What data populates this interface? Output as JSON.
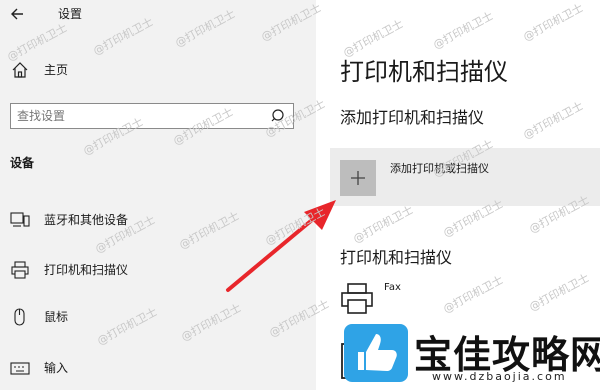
{
  "window": {
    "title": "设置"
  },
  "sidebar": {
    "home_label": "主页",
    "search_placeholder": "查找设置",
    "section_title": "设备",
    "items": [
      {
        "label": "蓝牙和其他设备",
        "icon": "bluetooth-devices-icon"
      },
      {
        "label": "打印机和扫描仪",
        "icon": "printer-icon"
      },
      {
        "label": "鼠标",
        "icon": "mouse-icon"
      },
      {
        "label": "输入",
        "icon": "keyboard-icon"
      }
    ]
  },
  "main": {
    "title": "打印机和扫描仪",
    "add_section_title": "添加打印机和扫描仪",
    "add_button_label": "添加打印机或扫描仪",
    "list_title": "打印机和扫描仪",
    "devices": [
      {
        "name": "Fax",
        "icon": "fax-printer-icon"
      }
    ]
  },
  "annotation": {
    "arrow_color": "#e8262b"
  },
  "watermark": {
    "text": "@打印机卫士",
    "brand_name": "宝佳攻略网",
    "brand_url": "www.dzbaojia.com",
    "brand_color": "#2fa3e6"
  }
}
